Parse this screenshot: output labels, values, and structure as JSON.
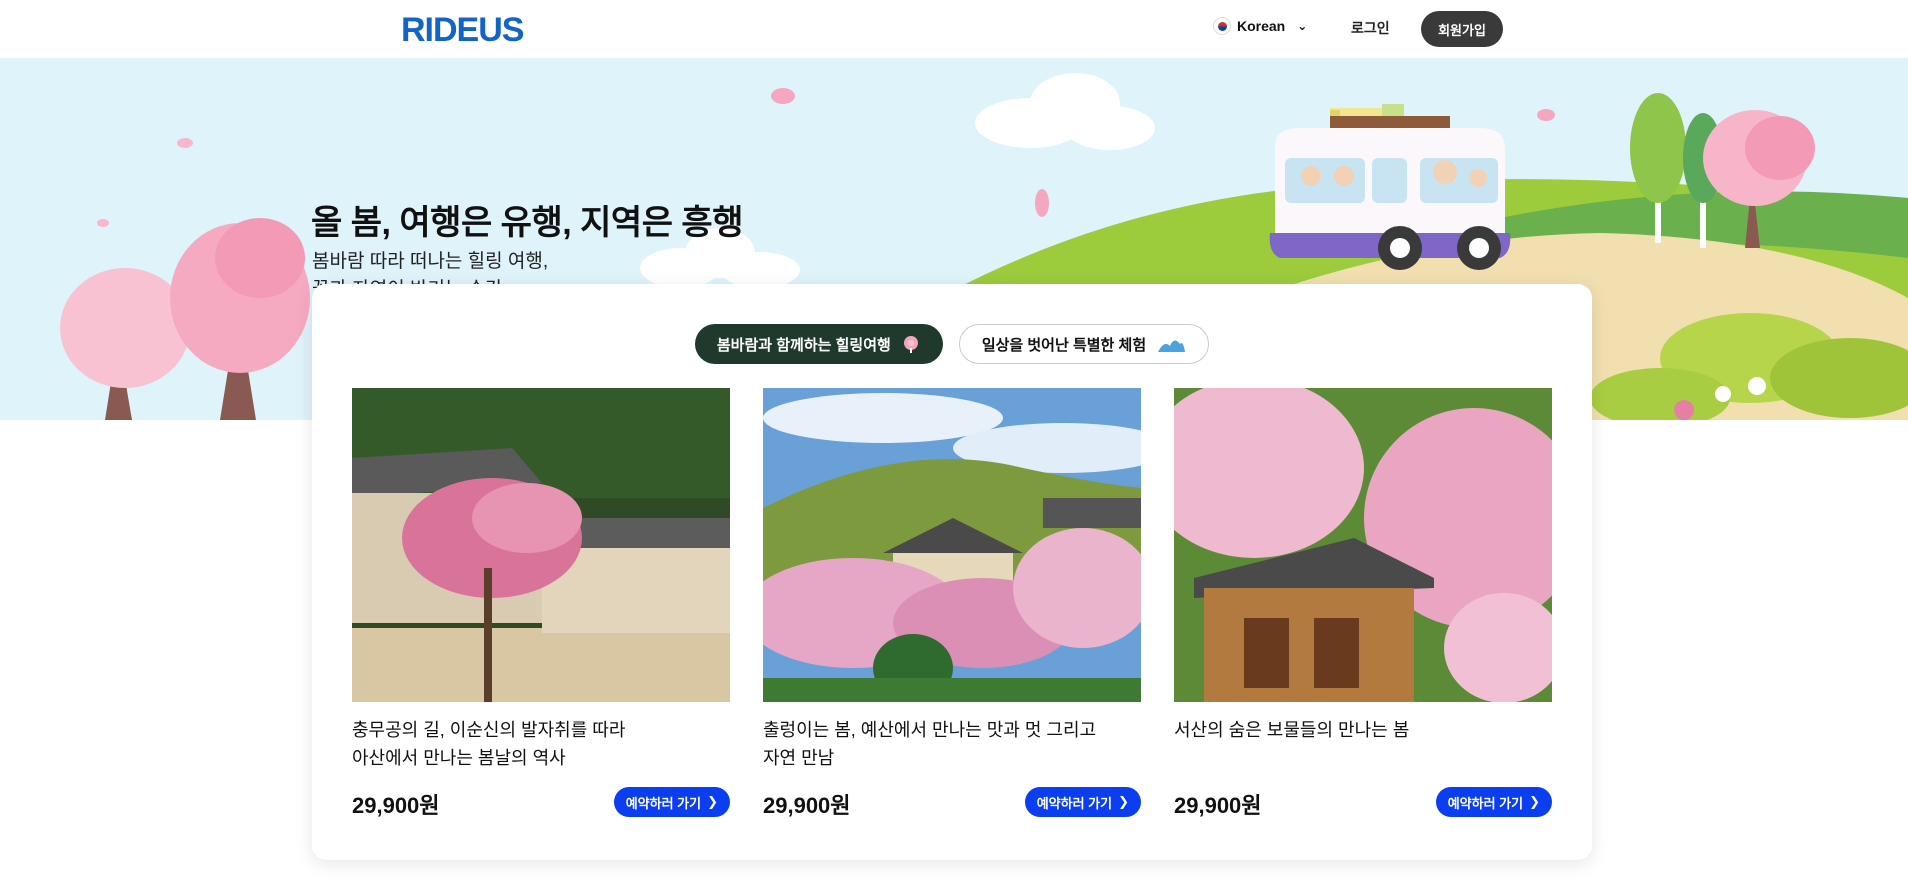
{
  "header": {
    "logo": "RIDEUS",
    "language": "Korean",
    "login_label": "로그인",
    "signup_label": "회원가입"
  },
  "hero": {
    "headline": "올 봄, 여행은 유행, 지역은 흥행",
    "subline_1": "봄바람 따라 떠나는 힐링 여행,",
    "subline_2": "꽃과 자연이 반기는 순간"
  },
  "tabs": [
    {
      "label": "봄바람과 함께하는 힐링여행",
      "icon": "cherry-blossom-icon",
      "active": true
    },
    {
      "label": "일상을 벗어난 특별한 체험",
      "icon": "wave-icon",
      "active": false
    }
  ],
  "products": [
    {
      "title_line_1": "충무공의 길, 이순신의 발자취를 따라",
      "title_line_2": "아산에서 만나는 봄날의 역사",
      "price": "29,900원",
      "button_label": "예약하러 가기"
    },
    {
      "title_line_1": "출렁이는 봄, 예산에서 만나는 맛과 멋 그리고",
      "title_line_2": "자연 만남",
      "price": "29,900원",
      "button_label": "예약하러 가기"
    },
    {
      "title_line_1": "서산의 숨은 보물들의 만나는 봄",
      "title_line_2": "",
      "price": "29,900원",
      "button_label": "예약하러 가기"
    }
  ],
  "colors": {
    "brand": "#1464c8",
    "book_button": "#0a3ef0",
    "active_tab": "#1f3a2d",
    "banner_sky": "#dff3fa"
  }
}
